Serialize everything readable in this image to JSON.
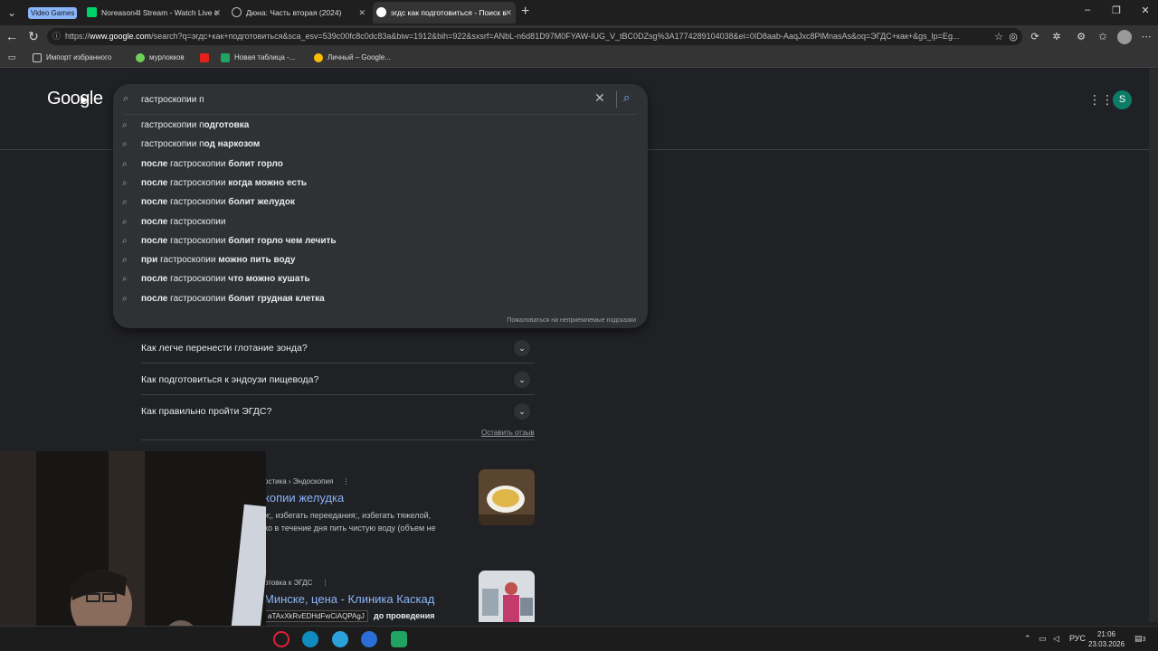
{
  "tabs": {
    "group_label": "Video Games",
    "items": [
      {
        "title": "Noreason4l Stream - Watch Live c"
      },
      {
        "title": "Дюна: Часть вторая (2024)"
      },
      {
        "title": "эгдс как подготовиться - Поиск в"
      }
    ]
  },
  "address": {
    "url_prefix": "https://",
    "url_host": "www.google.com",
    "url_rest": "/search?q=эгдс+как+подготовиться&sca_esv=539c00fc8c0dc83a&biw=1912&bih=922&sxsrf=ANbL-n6d81D97M0FYAW-IUG_V_tBC0DZsg%3A1774289104038&ei=0ID8aab-AaqJxc8PlMnasAs&oq=ЭГДС+как+&gs_lp=Eg..."
  },
  "bookmarks": [
    {
      "label": "Импорт избранного"
    },
    {
      "label": "мурлокков"
    },
    {
      "label": ""
    },
    {
      "label": "Новая таблица -..."
    },
    {
      "label": "Личный – Google..."
    }
  ],
  "google": {
    "logo": "Google",
    "avatar_letter": "S",
    "search_value": "гастроскопии п",
    "report_link": "Пожаловаться на неприемлемые подсказки",
    "suggestions": [
      {
        "pre": "",
        "mid": "гастроскопии п",
        "post": "одготовка"
      },
      {
        "pre": "",
        "mid": "гастроскопии п",
        "post": "од наркозом"
      },
      {
        "pre": "после",
        "mid": " гастроскопии ",
        "post": "болит горло"
      },
      {
        "pre": "после",
        "mid": " гастроскопии ",
        "post": "когда можно есть"
      },
      {
        "pre": "после",
        "mid": " гастроскопии ",
        "post": "болит желудок"
      },
      {
        "pre": "после",
        "mid": " гастроскопии",
        "post": ""
      },
      {
        "pre": "после",
        "mid": " гастроскопии ",
        "post": "болит горло чем лечить"
      },
      {
        "pre": "при",
        "mid": " гастроскопии ",
        "post": "можно пить воду"
      },
      {
        "pre": "после",
        "mid": " гастроскопии ",
        "post": "что можно кушать"
      },
      {
        "pre": "после",
        "mid": " гастроскопии ",
        "post": "болит грудная клетка"
      }
    ],
    "faq": [
      {
        "q": "Как легче перенести глотание зонда?"
      },
      {
        "q": "Как подготовиться к эндоузи пищевода?"
      },
      {
        "q": "Как правильно пройти ЭГДС?"
      }
    ],
    "feedback": "Оставить отзыв",
    "results": [
      {
        "crumb": "остика › Эндоскопия",
        "title": "копии желудка",
        "snippet_1": "и;, избегать переедания;, избегать тяжелой,",
        "snippet_2": "ко в течение дня пить чистую воду (объем не"
      },
      {
        "crumb": "отовка к ЭГДС",
        "title": "Минске, цена - Клиника Каскад",
        "tooltip": "aTAxXkRvEDHdFwCiAQPAgJ",
        "snippet_1": "до проведения"
      }
    ]
  },
  "taskbar": {
    "lang": "РУС",
    "time": "21:06",
    "date": "23.03.2026",
    "notif_count": "3"
  }
}
